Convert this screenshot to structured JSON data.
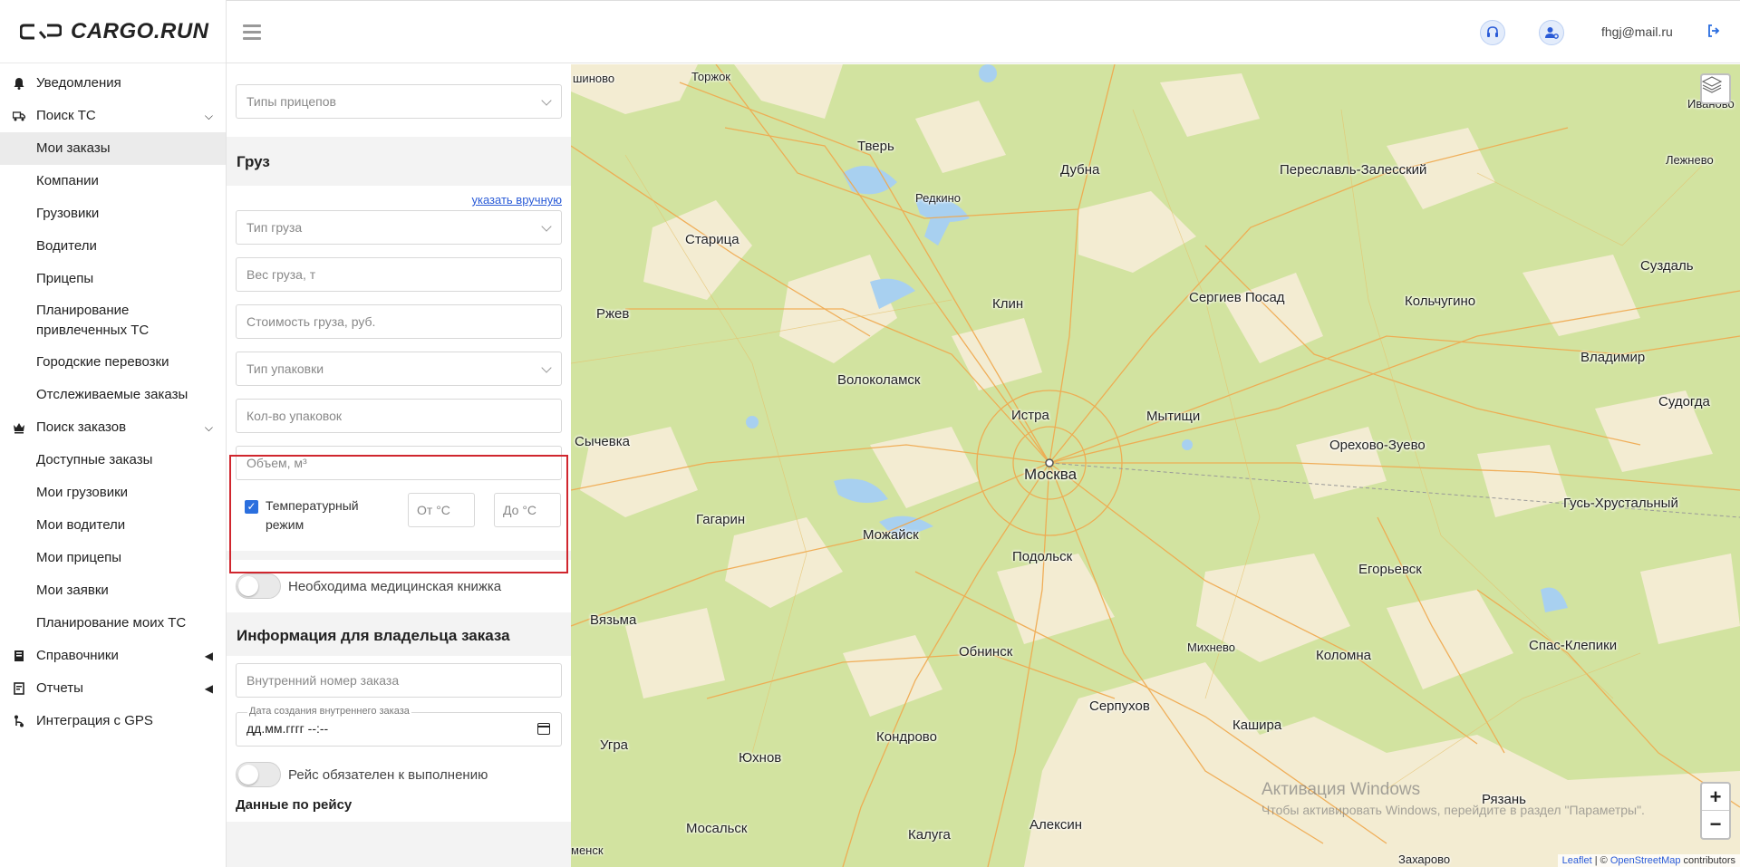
{
  "app": {
    "brand": "CARGO.RUN"
  },
  "topbar": {
    "user_email": "fhgj@mail.ru"
  },
  "sidebar": {
    "items": [
      {
        "label": "Уведомления",
        "icon": "bell-icon"
      },
      {
        "label": "Поиск ТС",
        "icon": "truck-icon"
      },
      {
        "label": "Мои заказы"
      },
      {
        "label": "Компании"
      },
      {
        "label": "Грузовики"
      },
      {
        "label": "Водители"
      },
      {
        "label": "Прицепы"
      },
      {
        "label": "Планирование привлеченных ТС"
      },
      {
        "label": "Городские перевозки"
      },
      {
        "label": "Отслеживаемые заказы"
      },
      {
        "label": "Поиск заказов",
        "icon": "crown-icon"
      },
      {
        "label": "Доступные заказы"
      },
      {
        "label": "Мои грузовики"
      },
      {
        "label": "Мои водители"
      },
      {
        "label": "Мои прицепы"
      },
      {
        "label": "Мои заявки"
      },
      {
        "label": "Планирование моих ТС"
      },
      {
        "label": "Справочники",
        "icon": "book-icon"
      },
      {
        "label": "Отчеты",
        "icon": "report-icon"
      },
      {
        "label": "Интеграция с GPS",
        "icon": "route-icon"
      }
    ]
  },
  "form": {
    "trailer_types_placeholder": "Типы прицепов",
    "cargo_title": "Груз",
    "manual_link": "указать вручную",
    "cargo_type_placeholder": "Тип груза",
    "weight_placeholder": "Вес груза, т",
    "cost_placeholder": "Стоимость груза, руб.",
    "package_type_placeholder": "Тип упаковки",
    "package_count_placeholder": "Кол-во упаковок",
    "volume_placeholder": "Объем, м³",
    "temp_mode_label": "Температурный режим",
    "temp_mode_checked": true,
    "temp_from_placeholder": "От °C",
    "temp_to_placeholder": "До °C",
    "med_book_label": "Необходима медицинская книжка",
    "owner_info_title": "Информация для владельца заказа",
    "internal_number_placeholder": "Внутренний номер заказа",
    "internal_date_label": "Дата создания внутреннего заказа",
    "internal_date_value": "дд.мм.гггг --:--",
    "trip_required_label": "Рейс обязателен к выполнению",
    "trip_data_title": "Данные по рейсу"
  },
  "map": {
    "cities": [
      "шиново",
      "Торжок",
      "Иваново",
      "Тверь",
      "Дубна",
      "Переславль-Залесский",
      "Лежнево",
      "Редкино",
      "Старица",
      "Суздаль",
      "Клин",
      "Сергиев Посад",
      "Кольчугино",
      "Ржев",
      "Владимир",
      "Волоколамск",
      "Судогда",
      "Истра",
      "Мытищи",
      "Сычевка",
      "Орехово-Зуево",
      "Москва",
      "Гагарин",
      "Можайск",
      "Гусь-Хрустальный",
      "Подольск",
      "Егорьевск",
      "Вязьма",
      "Михнево",
      "Обнинск",
      "Коломна",
      "Спас-Клепики",
      "Серпухов",
      "Кашира",
      "Кондрово",
      "Угра",
      "Юхнов",
      "Мосальск",
      "Калуга",
      "Алексин",
      "Рязань",
      "Захарово",
      "менск"
    ],
    "zoom_in": "+",
    "zoom_out": "−",
    "attribution_leaflet": "Leaflet",
    "attribution_sep": " | © ",
    "attribution_osm": "OpenStreetMap",
    "attribution_tail": " contributors",
    "watermark_title": "Активация Windows",
    "watermark_text": "Чтобы активировать Windows, перейдите в раздел \"Параметры\"."
  }
}
